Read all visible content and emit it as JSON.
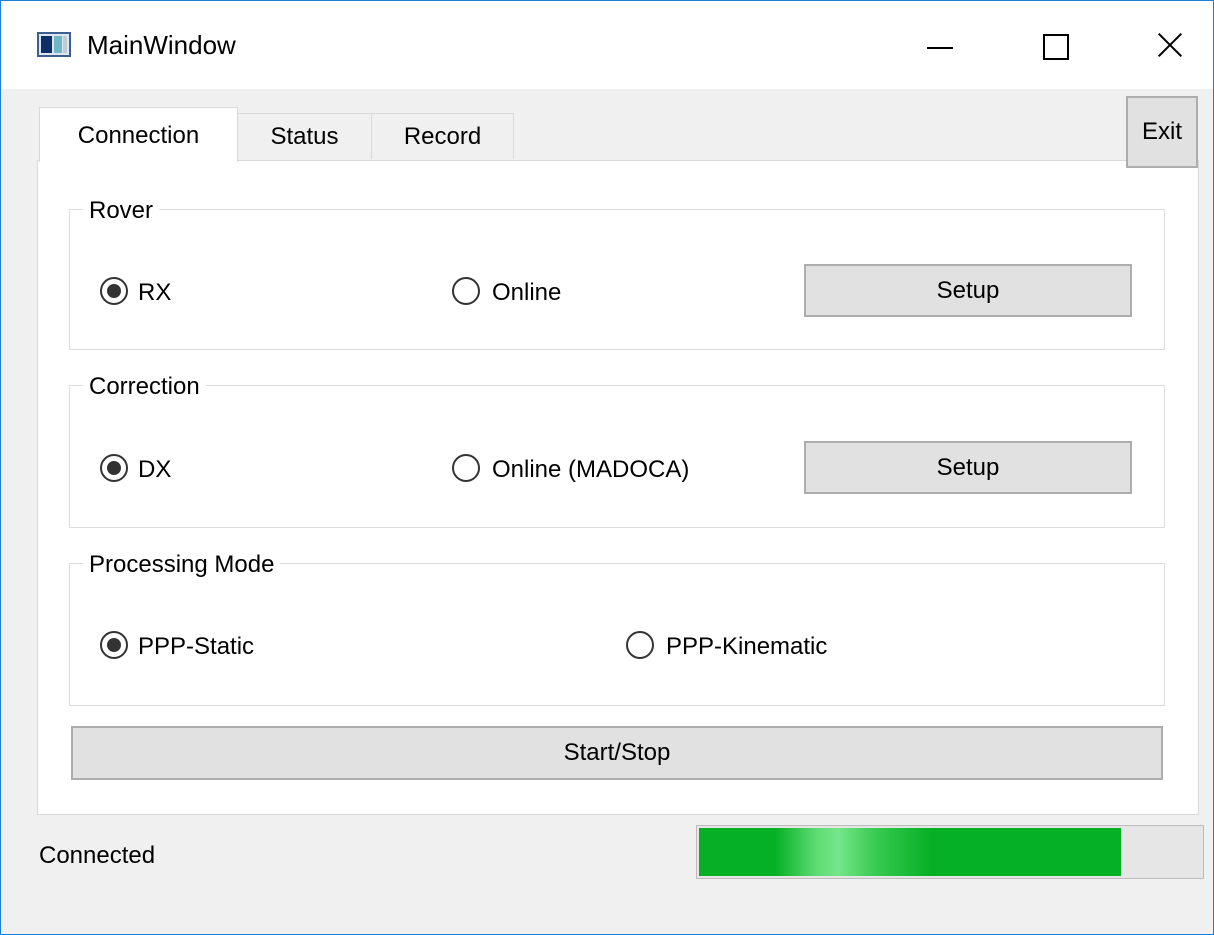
{
  "window": {
    "title": "MainWindow"
  },
  "tabs": [
    {
      "label": "Connection",
      "active": true
    },
    {
      "label": "Status",
      "active": false
    },
    {
      "label": "Record",
      "active": false
    }
  ],
  "exit_label": "Exit",
  "rover": {
    "title": "Rover",
    "options": [
      {
        "label": "RX",
        "checked": true
      },
      {
        "label": "Online",
        "checked": false
      }
    ],
    "setup_label": "Setup"
  },
  "correction": {
    "title": "Correction",
    "options": [
      {
        "label": "DX",
        "checked": true
      },
      {
        "label": "Online (MADOCA)",
        "checked": false
      }
    ],
    "setup_label": "Setup"
  },
  "processing": {
    "title": "Processing Mode",
    "options": [
      {
        "label": "PPP-Static",
        "checked": true
      },
      {
        "label": "PPP-Kinematic",
        "checked": false
      }
    ]
  },
  "start_stop_label": "Start/Stop",
  "status": {
    "text": "Connected",
    "progress_fraction": 0.84
  },
  "colors": {
    "progress_green": "#06b025",
    "window_border": "#1a7fd6"
  },
  "icons": {
    "app": "app-window-icon",
    "minimize": "minimize-icon",
    "maximize": "maximize-icon",
    "close": "close-icon"
  }
}
